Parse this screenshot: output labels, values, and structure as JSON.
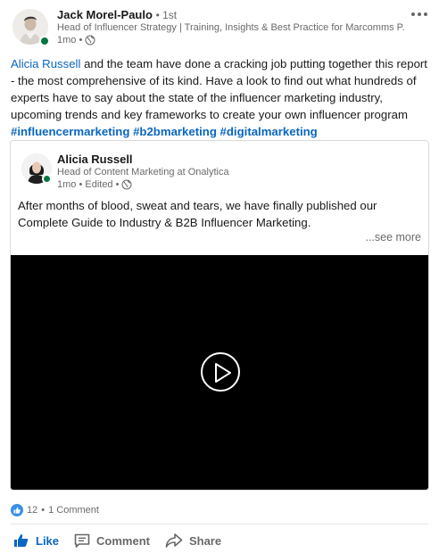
{
  "author": {
    "name": "Jack Morel-Paulo",
    "degree": "• 1st",
    "headline": "Head of Influencer Strategy | Training, Insights & Best Practice for Marcomms P...",
    "time": "1mo •",
    "visibility_icon": "globe-icon"
  },
  "commentary": {
    "mention": "Alicia Russell",
    "text": " and the team have done a cracking job putting together this report - the most comprehensive of its kind. Have a look to find out what hundreds of experts have to say about the state of the influencer marketing industry, upcoming trends and key frameworks to create your own influencer program",
    "hashtags": [
      "#influencermarketing",
      "#b2bmarketing",
      "#digitalmarketing"
    ]
  },
  "shared_post": {
    "author": {
      "name": "Alicia Russell",
      "headline": "Head of Content Marketing at Onalytica",
      "time": "1mo • Edited •",
      "visibility_icon": "globe-icon"
    },
    "text": "After months of blood, sweat and tears, we have finally published our Complete Guide to Industry & B2B Influencer Marketing.",
    "see_more": "...see more",
    "video": {
      "play_icon": "play-icon"
    }
  },
  "social": {
    "reaction_count": "12",
    "separator": "•",
    "comments": "1 Comment"
  },
  "actions": {
    "like": "Like",
    "comment": "Comment",
    "share": "Share"
  },
  "colors": {
    "link": "#0a66c2",
    "presence": "#057642",
    "like_bubble": "#378fe9",
    "video_bg": "#000000"
  }
}
